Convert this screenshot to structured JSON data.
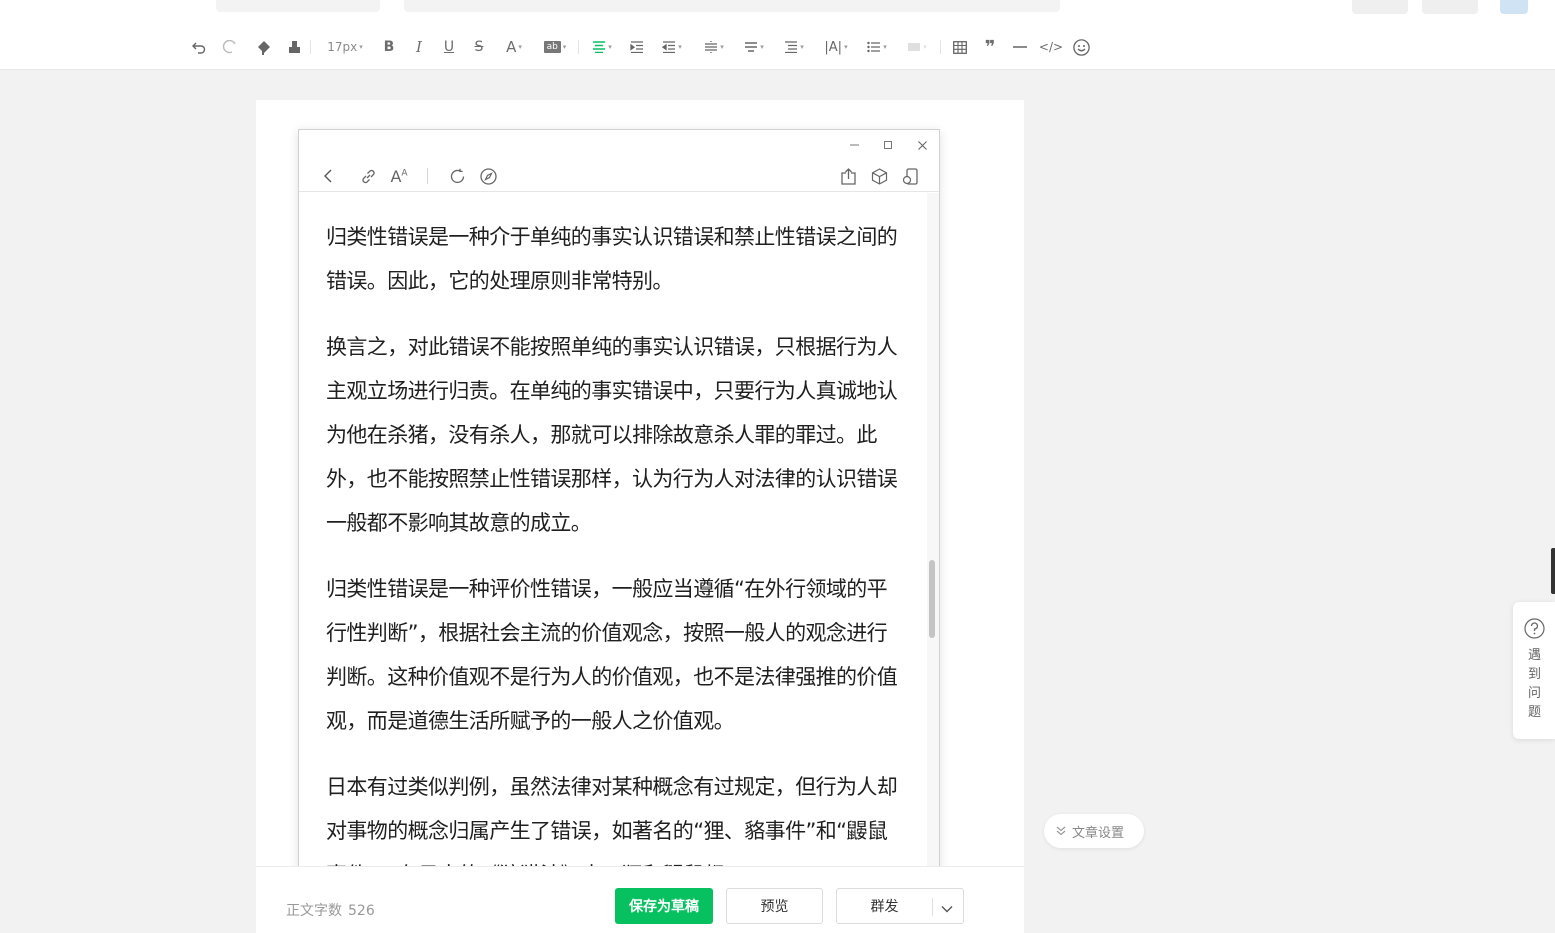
{
  "toolbar": {
    "font_size": "17px",
    "icons": [
      "undo-icon",
      "redo-icon",
      "format-painter-icon",
      "clear-format-icon",
      "bold-icon",
      "italic-icon",
      "underline-icon",
      "strikethrough-icon",
      "font-color-icon",
      "background-color-icon",
      "align-center-icon",
      "indent-icon",
      "outdent-icon",
      "paragraph-spacing-icon",
      "line-height-icon",
      "list-spacing-icon",
      "letter-spacing-icon",
      "bullet-list-icon",
      "table-icon",
      "quote-icon",
      "divider-icon",
      "code-icon",
      "emoji-icon"
    ]
  },
  "preview_window": {
    "controls": [
      "minimize-icon",
      "maximize-icon",
      "close-icon"
    ],
    "nav_icons": [
      "back-icon",
      "link-icon",
      "font-size-icon",
      "refresh-icon",
      "compass-icon",
      "share-icon",
      "cube-icon",
      "device-icon"
    ],
    "paragraphs": [
      "归类性错误是一种介于单纯的事实认识错误和禁止性错误之间的错误。因此，它的处理原则非常特别。",
      "换言之，对此错误不能按照单纯的事实认识错误，只根据行为人主观立场进行归责。在单纯的事实错误中，只要行为人真诚地认为他在杀猪，没有杀人，那就可以排除故意杀人罪的罪过。此外，也不能按照禁止性错误那样，认为行为人对法律的认识错误一般都不影响其故意的成立。",
      "归类性错误是一种评价性错误，一般应当遵循“在外行领域的平行性判断”，根据社会主流的价值观念，按照一般人的观念进行判断。这种价值观不是行为人的价值观，也不是法律强推的价值观，而是道德生活所赋予的一般人之价值观。",
      "日本有过类似判例，虽然法律对某种概念有过规定，但行为人却对事物的概念归属产生了错误，如著名的“狸、貉事件”和“鼹鼠事件”。在日本的《狩猎法》中，狸和鼹鼠都"
    ]
  },
  "bottom_bar": {
    "word_count_label": "正文字数",
    "word_count_value": "526",
    "save_draft": "保存为草稿",
    "preview": "预览",
    "mass_send": "群发"
  },
  "side": {
    "article_settings": "文章设置",
    "help": "遇到问题"
  },
  "colors": {
    "accent_green": "#07c160",
    "background": "#f2f2f3"
  }
}
